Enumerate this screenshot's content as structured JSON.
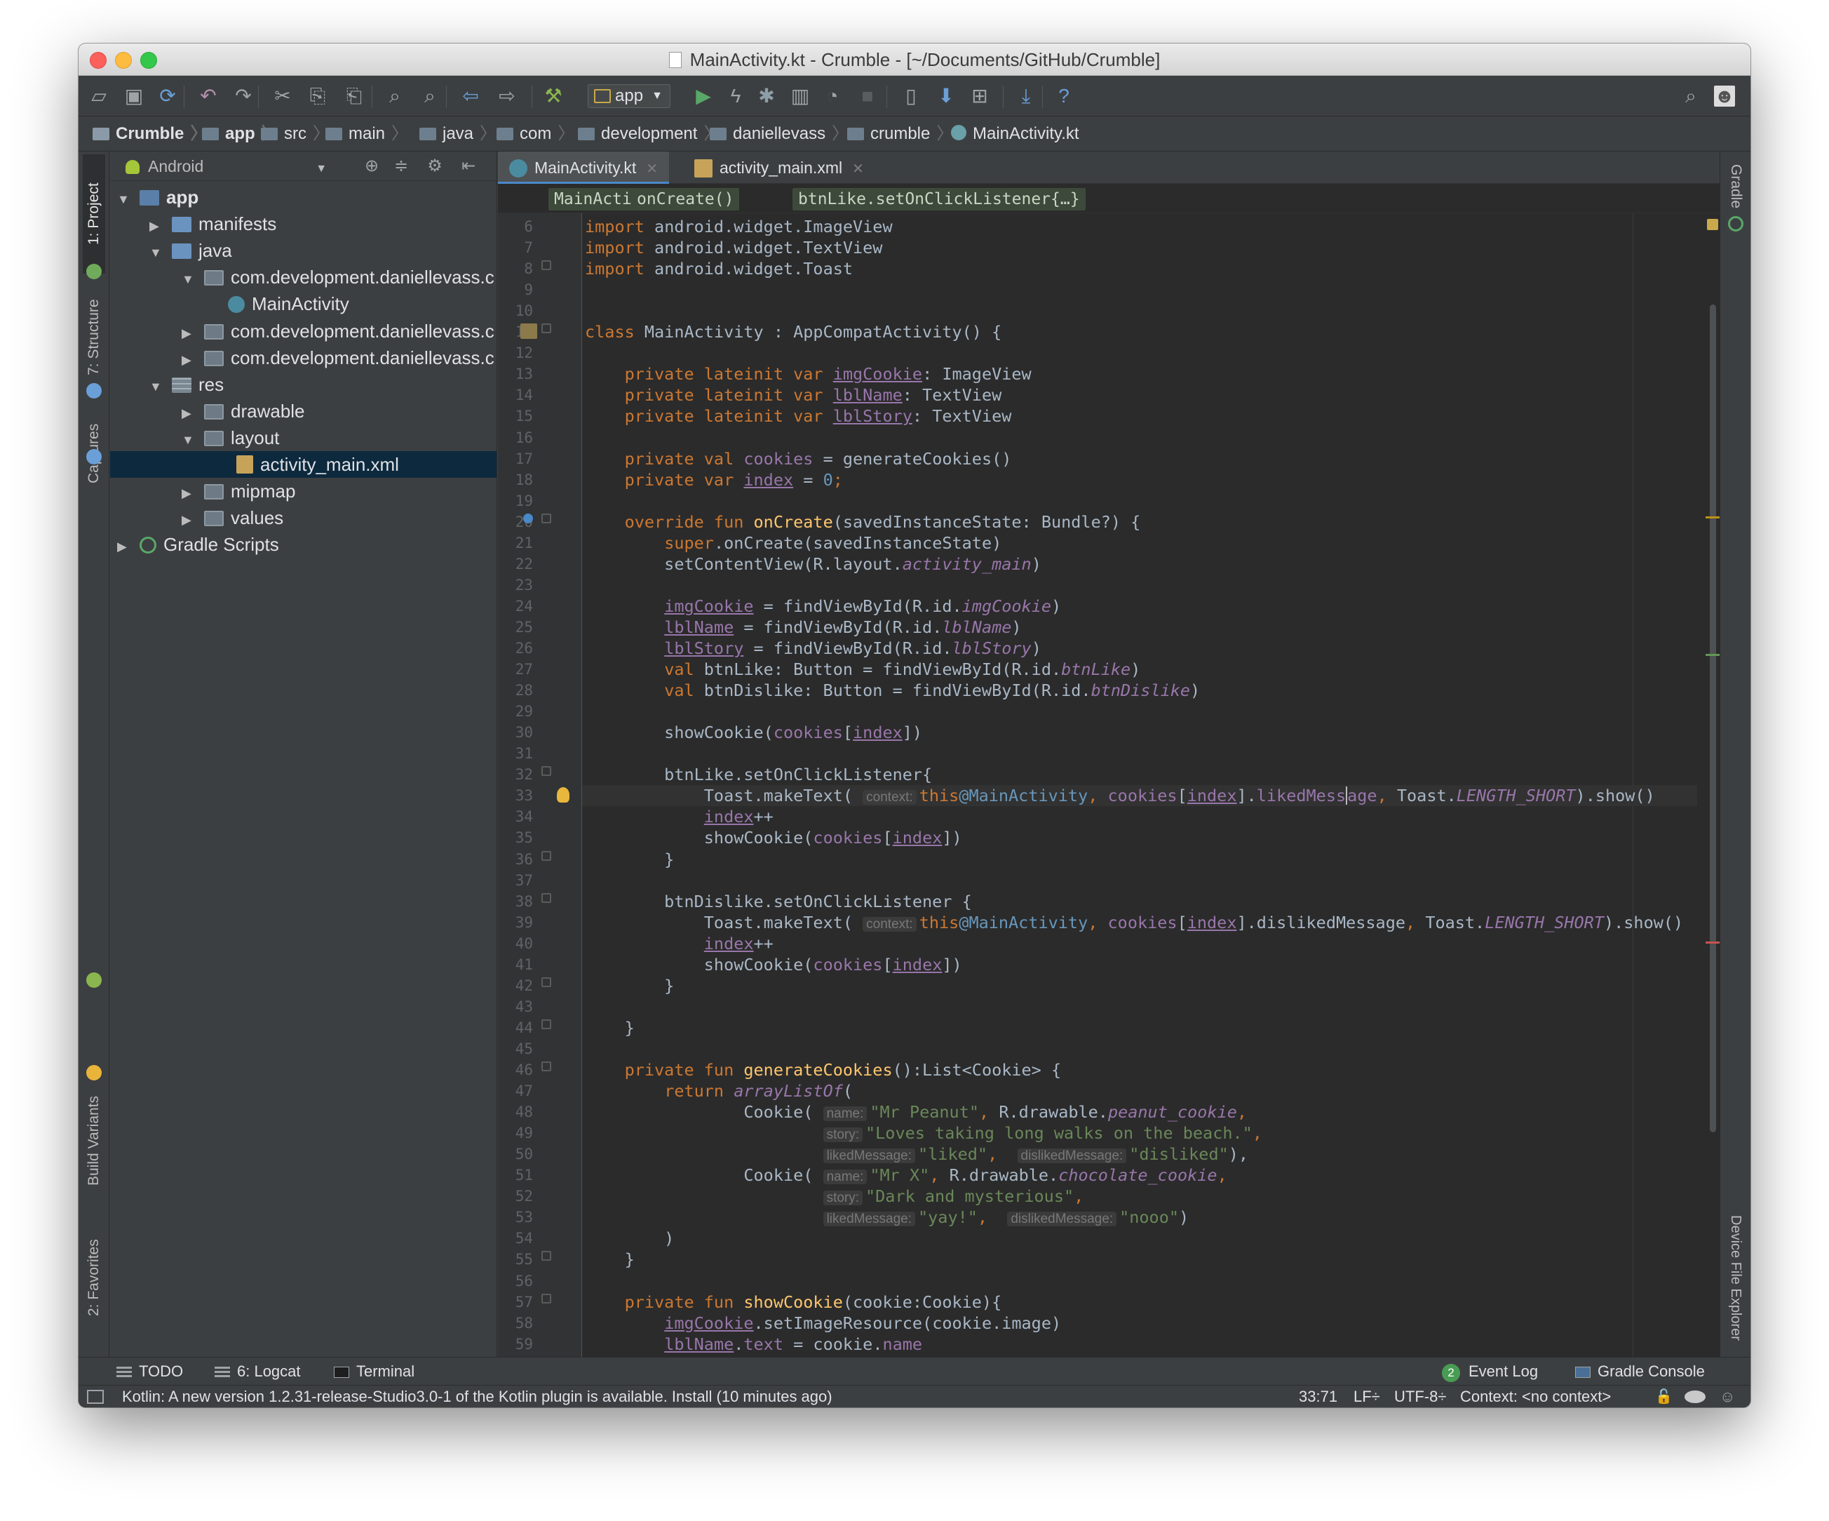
{
  "window": {
    "title": "MainActivity.kt - Crumble - [~/Documents/GitHub/Crumble]"
  },
  "toolbar": {
    "run_config": "app"
  },
  "navbar": {
    "crumbs": [
      "Crumble",
      "app",
      "src",
      "main",
      "java",
      "com",
      "development",
      "daniellevass",
      "crumble",
      "MainActivity.kt"
    ]
  },
  "left_strip": {
    "project": "1: Project",
    "structure": "7: Structure",
    "captures": "Captures",
    "build_variants": "Build Variants",
    "favorites": "2: Favorites"
  },
  "right_strip": {
    "gradle": "Gradle",
    "device_file_explorer": "Device File Explorer"
  },
  "project": {
    "view": "Android",
    "tree": [
      {
        "label": "app",
        "depth": 0,
        "arrow": "▼",
        "type": "module"
      },
      {
        "label": "manifests",
        "depth": 1,
        "arrow": "▶",
        "type": "folder"
      },
      {
        "label": "java",
        "depth": 1,
        "arrow": "▼",
        "type": "folder"
      },
      {
        "label": "com.development.daniellevass.c",
        "depth": 2,
        "arrow": "▼",
        "type": "package"
      },
      {
        "label": "MainActivity",
        "depth": 3,
        "arrow": "",
        "type": "kotlin"
      },
      {
        "label": "com.development.daniellevass.c",
        "depth": 2,
        "arrow": "▶",
        "type": "package"
      },
      {
        "label": "com.development.daniellevass.c",
        "depth": 2,
        "arrow": "▶",
        "type": "package"
      },
      {
        "label": "res",
        "depth": 1,
        "arrow": "▼",
        "type": "res"
      },
      {
        "label": "drawable",
        "depth": 2,
        "arrow": "▶",
        "type": "package"
      },
      {
        "label": "layout",
        "depth": 2,
        "arrow": "▼",
        "type": "package"
      },
      {
        "label": "activity_main.xml",
        "depth": 3,
        "arrow": "",
        "type": "xml",
        "selected": true
      },
      {
        "label": "mipmap",
        "depth": 2,
        "arrow": "▶",
        "type": "package"
      },
      {
        "label": "values",
        "depth": 2,
        "arrow": "▶",
        "type": "package"
      },
      {
        "label": "Gradle Scripts",
        "depth": 0,
        "arrow": "▶",
        "type": "gradle"
      }
    ]
  },
  "editor": {
    "tabs": [
      {
        "label": "MainActivity.kt",
        "active": true
      },
      {
        "label": "activity_main.xml",
        "active": false
      }
    ],
    "breadcrumbs": [
      "MainActivity",
      "onCreate()",
      "btnLike.setOnClickListener{…}"
    ],
    "first_line": 6,
    "lines": [
      [
        [
          "kw",
          "import "
        ],
        [
          "",
          "android.widget.ImageView"
        ]
      ],
      [
        [
          "kw",
          "import "
        ],
        [
          "",
          "android.widget.TextView"
        ]
      ],
      [
        [
          "kw",
          "import "
        ],
        [
          "",
          "android.widget.Toast"
        ]
      ],
      [],
      [],
      [
        [
          "kw",
          "class "
        ],
        [
          "",
          "MainActivity : AppCompatActivity() {"
        ]
      ],
      [],
      [
        [
          "",
          "    "
        ],
        [
          "kw",
          "private lateinit var "
        ],
        [
          "pr u",
          "imgCookie"
        ],
        [
          "",
          ": ImageView"
        ]
      ],
      [
        [
          "",
          "    "
        ],
        [
          "kw",
          "private lateinit var "
        ],
        [
          "pr u",
          "lblName"
        ],
        [
          "",
          ": TextView"
        ]
      ],
      [
        [
          "",
          "    "
        ],
        [
          "kw",
          "private lateinit var "
        ],
        [
          "pr u",
          "lblStory"
        ],
        [
          "",
          ": TextView"
        ]
      ],
      [],
      [
        [
          "",
          "    "
        ],
        [
          "kw",
          "private val "
        ],
        [
          "pr",
          "cookies"
        ],
        [
          "",
          " = generateCookies()"
        ]
      ],
      [
        [
          "",
          "    "
        ],
        [
          "kw",
          "private var "
        ],
        [
          "pr u",
          "index"
        ],
        [
          "",
          " = "
        ],
        [
          "lb",
          "0"
        ],
        [
          "kw",
          ";"
        ]
      ],
      [],
      [
        [
          "",
          "    "
        ],
        [
          "kw",
          "override fun "
        ],
        [
          "fn",
          "onCreate"
        ],
        [
          "",
          "(savedInstanceState: Bundle?) {"
        ]
      ],
      [
        [
          "",
          "        "
        ],
        [
          "kw",
          "super"
        ],
        [
          "",
          ".onCreate(savedInstanceState)"
        ]
      ],
      [
        [
          "",
          "        setContentView(R.layout."
        ],
        [
          "it",
          "activity_main"
        ],
        [
          "",
          ")"
        ]
      ],
      [],
      [
        [
          "",
          "        "
        ],
        [
          "pr u",
          "imgCookie"
        ],
        [
          "",
          " = findViewById(R.id."
        ],
        [
          "it",
          "imgCookie"
        ],
        [
          "",
          ")"
        ]
      ],
      [
        [
          "",
          "        "
        ],
        [
          "pr u",
          "lblName"
        ],
        [
          "",
          " = findViewById(R.id."
        ],
        [
          "it",
          "lblName"
        ],
        [
          "",
          ")"
        ]
      ],
      [
        [
          "",
          "        "
        ],
        [
          "pr u",
          "lblStory"
        ],
        [
          "",
          " = findViewById(R.id."
        ],
        [
          "it",
          "lblStory"
        ],
        [
          "",
          ")"
        ]
      ],
      [
        [
          "",
          "        "
        ],
        [
          "kw",
          "val "
        ],
        [
          "",
          "btnLike: Button = findViewById(R.id."
        ],
        [
          "it",
          "btnLike"
        ],
        [
          "",
          ")"
        ]
      ],
      [
        [
          "",
          "        "
        ],
        [
          "kw",
          "val "
        ],
        [
          "",
          "btnDislike: Button = findViewById(R.id."
        ],
        [
          "it",
          "btnDislike"
        ],
        [
          "",
          ")"
        ]
      ],
      [],
      [
        [
          "",
          "        showCookie("
        ],
        [
          "pr",
          "cookies"
        ],
        [
          "",
          "["
        ],
        [
          "pr u",
          "index"
        ],
        [
          "",
          "])"
        ]
      ],
      [],
      [
        [
          "",
          "        btnLike.setOnClickListener{"
        ]
      ],
      [
        [
          "",
          "            Toast.makeText( "
        ],
        [
          "hint",
          "context:"
        ],
        [
          "kw",
          "this"
        ],
        [
          "lb",
          "@MainActivity"
        ],
        [
          "kw",
          ", "
        ],
        [
          "pr",
          "cookies"
        ],
        [
          "",
          "["
        ],
        [
          "pr u",
          "index"
        ],
        [
          "",
          "]."
        ],
        [
          "pr",
          "likedMess"
        ],
        [
          "caret",
          ""
        ],
        [
          "pr",
          "age"
        ],
        [
          "kw",
          ", "
        ],
        [
          "",
          "Toast."
        ],
        [
          "it",
          "LENGTH_SHORT"
        ],
        [
          "",
          ").show()"
        ]
      ],
      [
        [
          "",
          "            "
        ],
        [
          "pr u",
          "index"
        ],
        [
          "",
          "++"
        ]
      ],
      [
        [
          "",
          "            showCookie("
        ],
        [
          "pr",
          "cookies"
        ],
        [
          "",
          "["
        ],
        [
          "pr u",
          "index"
        ],
        [
          "",
          "])"
        ]
      ],
      [
        [
          "",
          "        }"
        ]
      ],
      [],
      [
        [
          "",
          "        btnDislike.setOnClickListener {"
        ]
      ],
      [
        [
          "",
          "            Toast.makeText( "
        ],
        [
          "hint",
          "context:"
        ],
        [
          "kw",
          "this"
        ],
        [
          "lb",
          "@MainActivity"
        ],
        [
          "kw",
          ", "
        ],
        [
          "pr",
          "cookies"
        ],
        [
          "",
          "["
        ],
        [
          "pr u",
          "index"
        ],
        [
          "",
          "].dislikedMessage"
        ],
        [
          "kw",
          ", "
        ],
        [
          "",
          "Toast."
        ],
        [
          "it",
          "LENGTH_SHORT"
        ],
        [
          "",
          ").show()"
        ]
      ],
      [
        [
          "",
          "            "
        ],
        [
          "pr u",
          "index"
        ],
        [
          "",
          "++"
        ]
      ],
      [
        [
          "",
          "            showCookie("
        ],
        [
          "pr",
          "cookies"
        ],
        [
          "",
          "["
        ],
        [
          "pr u",
          "index"
        ],
        [
          "",
          "])"
        ]
      ],
      [
        [
          "",
          "        }"
        ]
      ],
      [],
      [
        [
          "",
          "    }"
        ]
      ],
      [],
      [
        [
          "",
          "    "
        ],
        [
          "kw",
          "private fun "
        ],
        [
          "fn",
          "generateCookies"
        ],
        [
          "",
          "():List<Cookie> {"
        ]
      ],
      [
        [
          "",
          "        "
        ],
        [
          "kw",
          "return "
        ],
        [
          "it",
          "arrayListOf"
        ],
        [
          "",
          "("
        ]
      ],
      [
        [
          "",
          "                Cookie( "
        ],
        [
          "hint",
          "name:"
        ],
        [
          "str",
          "\"Mr Peanut\""
        ],
        [
          "kw",
          ", "
        ],
        [
          "",
          "R.drawable."
        ],
        [
          "it",
          "peanut_cookie"
        ],
        [
          "kw",
          ","
        ]
      ],
      [
        [
          "",
          "                        "
        ],
        [
          "hint",
          "story:"
        ],
        [
          "str",
          "\"Loves taking long walks on the beach.\""
        ],
        [
          "kw",
          ","
        ]
      ],
      [
        [
          "",
          "                        "
        ],
        [
          "hint",
          "likedMessage:"
        ],
        [
          "str",
          "\"liked\""
        ],
        [
          "kw",
          ",  "
        ],
        [
          "hint",
          "dislikedMessage:"
        ],
        [
          "str",
          "\"disliked\""
        ],
        [
          "",
          "),"
        ]
      ],
      [
        [
          "",
          "                Cookie( "
        ],
        [
          "hint",
          "name:"
        ],
        [
          "str",
          "\"Mr X\""
        ],
        [
          "kw",
          ", "
        ],
        [
          "",
          "R.drawable."
        ],
        [
          "it",
          "chocolate_cookie"
        ],
        [
          "kw",
          ","
        ]
      ],
      [
        [
          "",
          "                        "
        ],
        [
          "hint",
          "story:"
        ],
        [
          "str",
          "\"Dark and mysterious\""
        ],
        [
          "kw",
          ","
        ]
      ],
      [
        [
          "",
          "                        "
        ],
        [
          "hint",
          "likedMessage:"
        ],
        [
          "str",
          "\"yay!\""
        ],
        [
          "kw",
          ",  "
        ],
        [
          "hint",
          "dislikedMessage:"
        ],
        [
          "str",
          "\"nooo\""
        ],
        [
          "",
          ")"
        ]
      ],
      [
        [
          "",
          "        )"
        ]
      ],
      [
        [
          "",
          "    }"
        ]
      ],
      [],
      [
        [
          "",
          "    "
        ],
        [
          "kw",
          "private fun "
        ],
        [
          "fn",
          "showCookie"
        ],
        [
          "",
          "(cookie:Cookie){"
        ]
      ],
      [
        [
          "",
          "        "
        ],
        [
          "pr u",
          "imgCookie"
        ],
        [
          "",
          ".setImageResource(cookie.image)"
        ]
      ],
      [
        [
          "",
          "        "
        ],
        [
          "pr u",
          "lblName"
        ],
        [
          "",
          "."
        ],
        [
          "pr",
          "text"
        ],
        [
          "",
          " = cookie."
        ],
        [
          "pr",
          "name"
        ]
      ]
    ]
  },
  "bottom_tools": {
    "todo": "TODO",
    "logcat": "6: Logcat",
    "terminal": "Terminal",
    "event_log": "Event Log",
    "event_count": "2",
    "gradle_console": "Gradle Console"
  },
  "status": {
    "message": "Kotlin: A new version 1.2.31-release-Studio3.0-1 of the Kotlin plugin is available. Install (10 minutes ago)",
    "position": "33:71",
    "line_sep": "LF÷",
    "encoding": "UTF-8÷",
    "context": "Context: <no context>"
  },
  "colors": {
    "accent": "#4a88c7",
    "keyword": "#cc7832",
    "string": "#6a8759",
    "function": "#ffc66d",
    "property": "#9876aa",
    "number": "#6897bb",
    "editor_bg": "#2b2b2b",
    "panel_bg": "#3c3f41",
    "selection": "#0d293e"
  },
  "icons": [
    "folder-icon",
    "save-icon",
    "sync-icon",
    "undo-icon",
    "redo-icon",
    "cut-icon",
    "copy-icon",
    "paste-icon",
    "find-icon",
    "replace-icon",
    "back-icon",
    "forward-icon",
    "build-icon",
    "run-icon",
    "apply-changes-icon",
    "debug-icon",
    "profile-icon",
    "attach-debugger-icon",
    "stop-icon",
    "avd-manager-icon",
    "sdk-manager-icon",
    "project-structure-icon",
    "download-icon",
    "help-icon",
    "search-icon",
    "user-icon"
  ]
}
